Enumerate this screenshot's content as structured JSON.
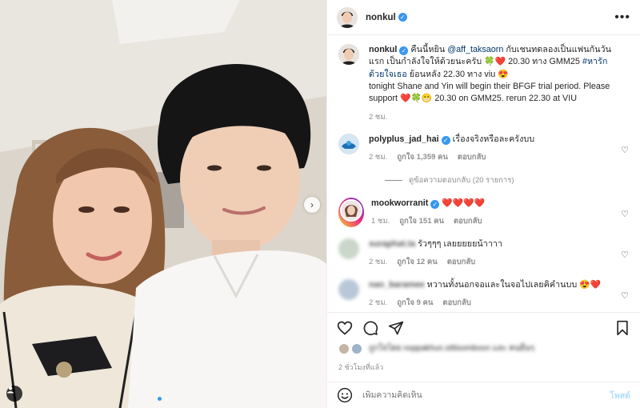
{
  "post": {
    "author": "nonkul",
    "photo_alt": "selfie photo",
    "carousel": {
      "count": 2,
      "current": 1
    }
  },
  "caption": {
    "username": "nonkul",
    "thai_line_1": "คืนนี้หยิน",
    "mention": "@aff_taksaorn",
    "thai_line_2": "กับเชนทดลองเป็นแฟนกันวันแรก เป็นกำลังใจให้ด้วยนะครับ",
    "thai_line_3": "20.30 ทาง GMM25",
    "hashtag": "#หารักด้วยใจเธอ",
    "thai_line_4": "ย้อนหลัง 22.30 ทาง viu",
    "english_1": "tonight Shane and Yin will begin their BFGF trial period. Please support",
    "english_2": "20.30 on GMM25. rerun 22.30 at VIU",
    "time": "2 ชม."
  },
  "comments": [
    {
      "username": "polyplus_jad_hai",
      "text": "เรื่องจริงหรือละครังบบ",
      "time": "2 ชม.",
      "likes": "ถูกใจ 1,359 คน",
      "reply": "ตอบกลับ",
      "view_replies": "ดูข้อความตอบกลับ (20 รายการ)"
    },
    {
      "username": "mookworranit",
      "text": "",
      "time": "1 ชม.",
      "likes": "ถูกใจ 151 คน",
      "reply": "ตอบกลับ"
    },
    {
      "username": "suraphat.ta",
      "text": "รัวๆๆๆ เลยยยยยน้าาาา",
      "time": "2 ชม.",
      "likes": "ถูกใจ 12 คน",
      "reply": "ตอบกลับ"
    },
    {
      "username": "nan_baramee",
      "text": "หวานทั้งนอกจอและในจอไปเลยคิคำนบบ",
      "time": "2 ชม.",
      "likes": "ถูกใจ 9 คน",
      "reply": "ตอบกลับ"
    }
  ],
  "likes_summary": "ถูกใจโดย noppakhun.sittisomboon และ คนอื่นๆ",
  "time_ago": "2 ชั่วโมงที่แล้ว",
  "composer": {
    "placeholder": "เพิ่มความคิดเห็น",
    "post_label": "โพสต์"
  },
  "colors": {
    "accent": "#3897f0",
    "heart": "#ed1d3a",
    "link": "#00376b"
  }
}
